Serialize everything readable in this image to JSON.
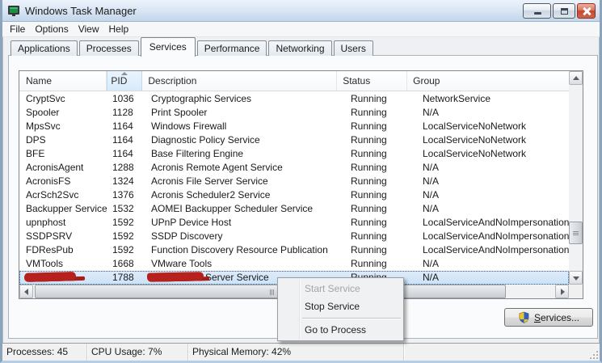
{
  "window": {
    "title": "Windows Task Manager"
  },
  "menu_bar": {
    "items": [
      {
        "label": "File"
      },
      {
        "label": "Options"
      },
      {
        "label": "View"
      },
      {
        "label": "Help"
      }
    ]
  },
  "tabs": [
    {
      "label": "Applications",
      "active": false
    },
    {
      "label": "Processes",
      "active": false
    },
    {
      "label": "Services",
      "active": true
    },
    {
      "label": "Performance",
      "active": false
    },
    {
      "label": "Networking",
      "active": false
    },
    {
      "label": "Users",
      "active": false
    }
  ],
  "services_table": {
    "columns": [
      {
        "label": "Name"
      },
      {
        "label": "PID",
        "sorted": "asc"
      },
      {
        "label": "Description"
      },
      {
        "label": "Status"
      },
      {
        "label": "Group"
      }
    ],
    "rows": [
      {
        "name": "CryptSvc",
        "pid": "1036",
        "description": "Cryptographic Services",
        "status": "Running",
        "group": "NetworkService"
      },
      {
        "name": "Spooler",
        "pid": "1128",
        "description": "Print Spooler",
        "status": "Running",
        "group": "N/A"
      },
      {
        "name": "MpsSvc",
        "pid": "1164",
        "description": "Windows Firewall",
        "status": "Running",
        "group": "LocalServiceNoNetwork"
      },
      {
        "name": "DPS",
        "pid": "1164",
        "description": "Diagnostic Policy Service",
        "status": "Running",
        "group": "LocalServiceNoNetwork"
      },
      {
        "name": "BFE",
        "pid": "1164",
        "description": "Base Filtering Engine",
        "status": "Running",
        "group": "LocalServiceNoNetwork"
      },
      {
        "name": "AcronisAgent",
        "pid": "1288",
        "description": "Acronis Remote Agent Service",
        "status": "Running",
        "group": "N/A"
      },
      {
        "name": "AcronisFS",
        "pid": "1324",
        "description": "Acronis File Server Service",
        "status": "Running",
        "group": "N/A"
      },
      {
        "name": "AcrSch2Svc",
        "pid": "1376",
        "description": "Acronis Scheduler2 Service",
        "status": "Running",
        "group": "N/A"
      },
      {
        "name": "Backupper Service",
        "pid": "1532",
        "description": "AOMEI Backupper Scheduler Service",
        "status": "Running",
        "group": "N/A"
      },
      {
        "name": "upnphost",
        "pid": "1592",
        "description": "UPnP Device Host",
        "status": "Running",
        "group": "LocalServiceAndNoImpersonation"
      },
      {
        "name": "SSDPSRV",
        "pid": "1592",
        "description": "SSDP Discovery",
        "status": "Running",
        "group": "LocalServiceAndNoImpersonation"
      },
      {
        "name": "FDResPub",
        "pid": "1592",
        "description": "Function Discovery Resource Publication",
        "status": "Running",
        "group": "LocalServiceAndNoImpersonation"
      },
      {
        "name": "VMTools",
        "pid": "1668",
        "description": "VMware Tools",
        "status": "Running",
        "group": "N/A"
      },
      {
        "name": "",
        "pid": "1788",
        "description": "Server Service",
        "status": "Running",
        "group": "N/A",
        "selected": true,
        "name_redacted": true,
        "description_redacted": true
      }
    ]
  },
  "context_menu": {
    "items": [
      {
        "label": "Start Service",
        "disabled": true
      },
      {
        "label": "Stop Service",
        "disabled": false
      },
      {
        "separator": true
      },
      {
        "label": "Go to Process",
        "disabled": false
      }
    ]
  },
  "services_button": {
    "underlined": "S",
    "rest": "ervices..."
  },
  "status_bar": {
    "processes": "Processes: 45",
    "cpu": "CPU Usage: 7%",
    "memory": "Physical Memory: 42%"
  },
  "colors": {
    "selection_highlight": "#cde3f6",
    "redaction_red": "#b6201d",
    "close_button_red": "#c2492f",
    "titlebar_blue": "#c3d6eb",
    "sorted_column_blue": "#d8eafa"
  }
}
